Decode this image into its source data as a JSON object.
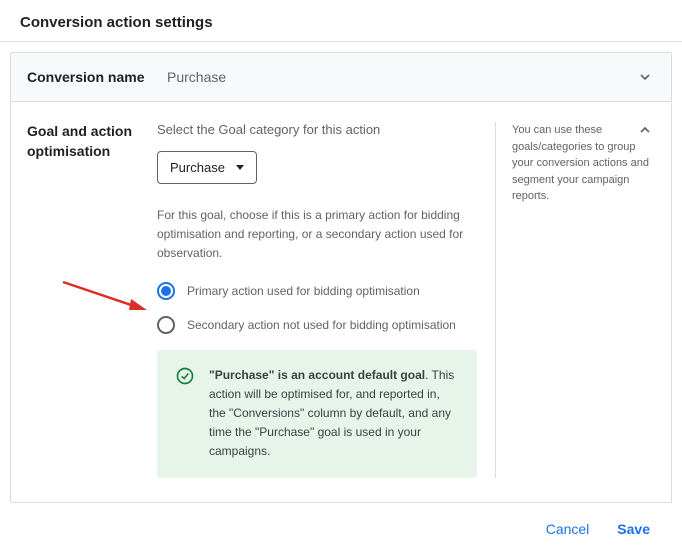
{
  "page_title": "Conversion action settings",
  "conversion_name_row": {
    "label": "Conversion name",
    "value": "Purchase"
  },
  "goal_section": {
    "heading": "Goal and action optimisation",
    "instruction": "Select the Goal category for this action",
    "selected_category": "Purchase",
    "help_text": "For this goal, choose if this is a primary action for bidding optimisation and reporting, or a secondary action used for observation.",
    "radio_options": [
      {
        "label": "Primary action used for bidding optimisation",
        "selected": true
      },
      {
        "label": "Secondary action not used for bidding optimisation",
        "selected": false
      }
    ],
    "info_bold": "\"Purchase\" is an account default goal",
    "info_rest": ". This action will be optimised for, and reported in, the \"Conversions\" column by default, and any time the \"Purchase\" goal is used in your campaigns.",
    "side_help": "You can use these goals/categories to group your conversion actions and segment your campaign reports."
  },
  "footer": {
    "cancel": "Cancel",
    "save": "Save"
  }
}
